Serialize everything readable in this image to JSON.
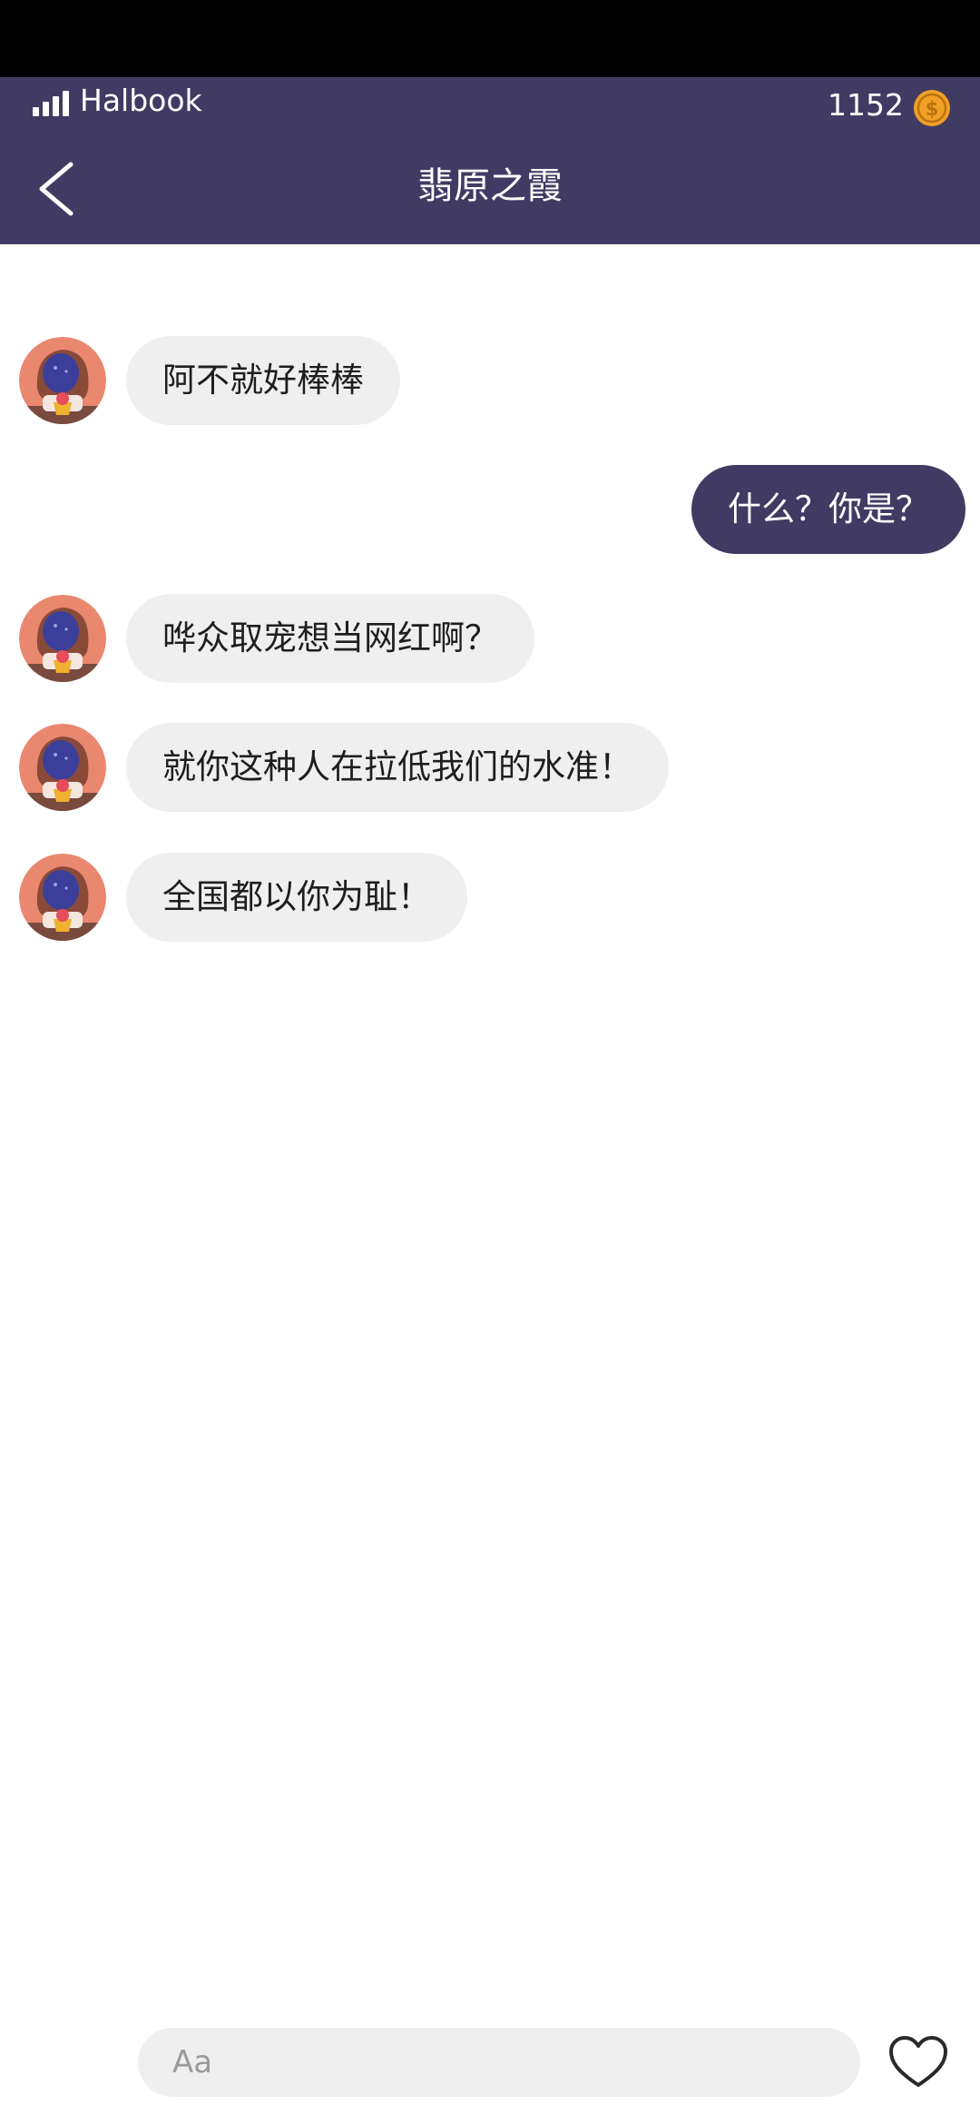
{
  "status": {
    "carrier": "Halbook"
  },
  "header": {
    "coins": "1152",
    "title": "翡原之霞",
    "accent_color": "#413b63",
    "coin_color": "#f0a024"
  },
  "messages": [
    {
      "side": "incoming",
      "text": "阿不就好棒棒"
    },
    {
      "side": "outgoing",
      "text": "什么？你是？"
    },
    {
      "side": "incoming",
      "text": "哗众取宠想当网红啊？"
    },
    {
      "side": "incoming",
      "text": "就你这种人在拉低我们的水准！"
    },
    {
      "side": "incoming",
      "text": "全国都以你为耻！"
    }
  ],
  "composer": {
    "placeholder": "Aa",
    "value": ""
  },
  "icons": {
    "back": "chevron-left-icon",
    "coin": "dollar-coin-icon",
    "like": "heart-outline-icon",
    "signal": "signal-bars-icon"
  }
}
